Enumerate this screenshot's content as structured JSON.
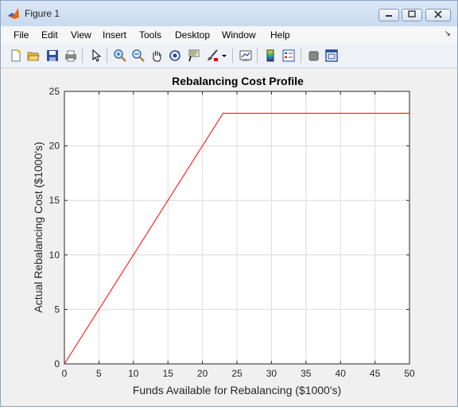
{
  "window": {
    "title": "Figure 1",
    "icon": "matlab-logo-icon",
    "controls": [
      "minimize",
      "maximize",
      "close"
    ]
  },
  "menu": {
    "items": [
      "File",
      "Edit",
      "View",
      "Insert",
      "Tools",
      "Desktop",
      "Window",
      "Help"
    ]
  },
  "toolbar": {
    "tools": [
      "new-figure-icon",
      "open-file-icon",
      "save-icon",
      "print-icon",
      "edit-plot-arrow-icon",
      "zoom-in-icon",
      "zoom-out-icon",
      "pan-hand-icon",
      "rotate-3d-icon",
      "data-cursor-icon",
      "brush-icon",
      "brush-dropdown-icon",
      "link-plot-icon",
      "insert-colorbar-icon",
      "insert-legend-icon",
      "hide-plot-tools-icon",
      "show-plot-tools-icon"
    ]
  },
  "chart_data": {
    "type": "line",
    "title": "Rebalancing Cost Profile",
    "xlabel": "Funds Available for Rebalancing ($1000's)",
    "ylabel": "Actual Rebalancing Cost ($1000's)",
    "xlim": [
      0,
      50
    ],
    "ylim": [
      0,
      25
    ],
    "xticks": [
      0,
      5,
      10,
      15,
      20,
      25,
      30,
      35,
      40,
      45,
      50
    ],
    "yticks": [
      0,
      5,
      10,
      15,
      20,
      25
    ],
    "grid": true,
    "series": [
      {
        "color": "#ff0000",
        "x": [
          0,
          23,
          50
        ],
        "y": [
          0,
          23,
          23
        ]
      }
    ]
  }
}
